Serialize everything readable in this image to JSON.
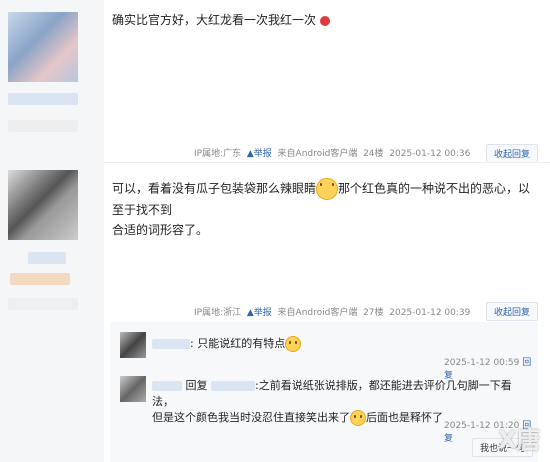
{
  "post1": {
    "text": "确实比官方好，大红龙看一次我红一次"
  },
  "meta1": {
    "ip": "IP属地:广东",
    "report": "举报",
    "source": "来自Android客户端",
    "floor": "24楼",
    "time": "2025-01-12 00:36",
    "collapse": "收起回复"
  },
  "post2": {
    "line1a": "可以，看着没有瓜子包装袋那么辣眼睛",
    "line1b": "那个红色真的一种说不出的恶心，以至于找不到",
    "line2": "合适的词形容了。"
  },
  "meta2": {
    "ip": "IP属地:浙江",
    "report": "举报",
    "source": "来自Android客户端",
    "floor": "27楼",
    "time": "2025-01-12 00:39",
    "collapse": "收起回复"
  },
  "sub1": {
    "text": ": 只能说红的有特点",
    "time": "2025-1-12 00:59",
    "reply": "回复"
  },
  "sub2": {
    "reply_word": "回复",
    "text_a": ":之前看说纸张说排版，都还能进去评价几句脚一下看法，",
    "text_b": "但是这个颜色我当时没忍住直接笑出来了",
    "text_c": "后面也是释怀了",
    "time": "2025-1-12 01:20",
    "reply": "回复"
  },
  "footer": {
    "reply_btn": "我也说一句",
    "watermark": "X唐"
  },
  "icons": {
    "report": "report-icon",
    "emoji": "smile-emoji-icon",
    "badge": "red-badge-icon"
  }
}
